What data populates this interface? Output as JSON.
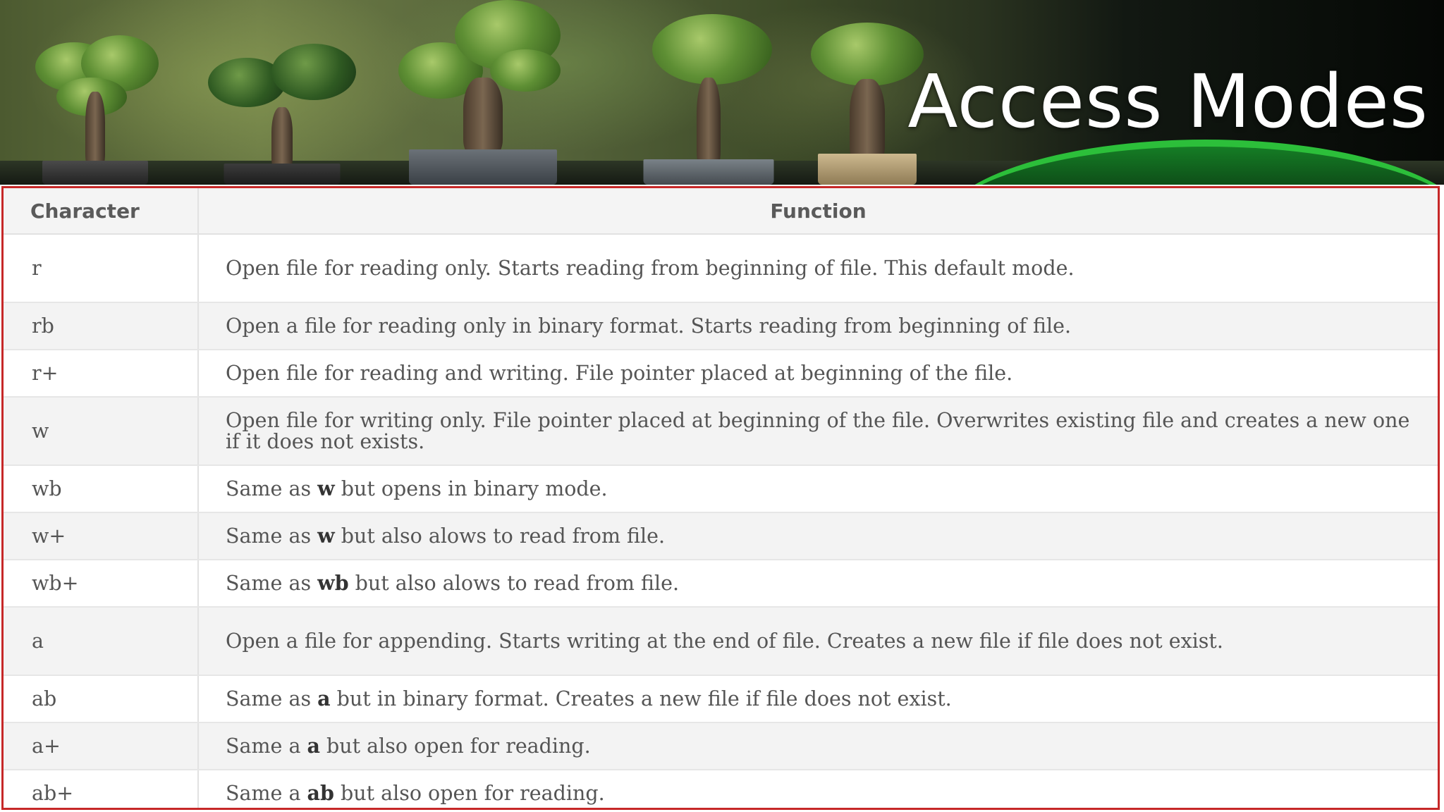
{
  "slide": {
    "title": "Access Modes"
  },
  "table": {
    "headers": {
      "character": "Character",
      "function": "Function"
    },
    "rows": [
      {
        "char": "r",
        "pre": "Open file for reading only. Starts reading from beginning of file. This default mode.",
        "kw": "",
        "post": ""
      },
      {
        "char": "rb",
        "pre": "Open a file for reading only in binary format. Starts reading from beginning of file.",
        "kw": "",
        "post": ""
      },
      {
        "char": "r+",
        "pre": "Open file for reading and writing. File pointer placed at beginning of the file.",
        "kw": "",
        "post": ""
      },
      {
        "char": "w",
        "pre": "Open file for writing only. File pointer placed at beginning of the file. Overwrites existing file and creates a new one if it does not exists.",
        "kw": "",
        "post": ""
      },
      {
        "char": "wb",
        "pre": "Same as ",
        "kw": "w",
        "post": " but opens in binary mode."
      },
      {
        "char": "w+",
        "pre": "Same as ",
        "kw": "w",
        "post": " but also alows to read from file."
      },
      {
        "char": "wb+",
        "pre": "Same as ",
        "kw": "wb",
        "post": " but also alows to read from file."
      },
      {
        "char": "a",
        "pre": "Open a file for appending. Starts writing at the end of file. Creates a new file if file does not exist.",
        "kw": "",
        "post": ""
      },
      {
        "char": "ab",
        "pre": "Same as ",
        "kw": "a",
        "post": " but in binary format. Creates a new file if file does not exist."
      },
      {
        "char": "a+",
        "pre": "Same a ",
        "kw": "a",
        "post": " but also open for reading."
      },
      {
        "char": "ab+",
        "pre": "Same a ",
        "kw": "ab",
        "post": " but also open for reading."
      }
    ]
  }
}
